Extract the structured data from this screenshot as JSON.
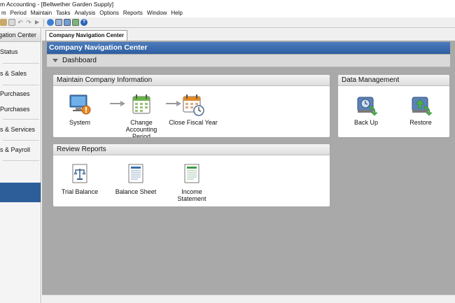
{
  "window": {
    "title": "m Accounting - [Bellwether Garden Supply]"
  },
  "menu": [
    "m",
    "Period",
    "Maintain",
    "Tasks",
    "Analysis",
    "Options",
    "Reports",
    "Window",
    "Help"
  ],
  "toolbar_icons": [
    "grid-icon",
    "paste-icon",
    "undo-icon",
    "redo-icon",
    "play-icon",
    "globe-icon",
    "calculator-icon",
    "table-icon",
    "edit-icon",
    "help-icon"
  ],
  "sidebar": {
    "header": "igation Center",
    "items": [
      "Status",
      "s & Sales",
      "Purchases",
      "Purchases",
      "s & Services",
      "s & Payroll"
    ]
  },
  "tab": {
    "label": "Company Navigation Center"
  },
  "banner": {
    "title": "Company Navigation Center"
  },
  "dashboard": {
    "label": "Dashboard"
  },
  "maintain_panel": {
    "title": "Maintain Company Information",
    "items": [
      "System",
      "Change Accounting Period",
      "Close Fiscal Year"
    ]
  },
  "data_panel": {
    "title": "Data Management",
    "items": [
      "Back Up",
      "Restore"
    ]
  },
  "reports_panel": {
    "title": "Review Reports",
    "items": [
      "Trial Balance",
      "Balance Sheet",
      "Income Statement"
    ]
  },
  "colors": {
    "banner": "#2d5ea0",
    "selected_nav": "#2e5e99",
    "workspace": "#a9a9a9"
  }
}
